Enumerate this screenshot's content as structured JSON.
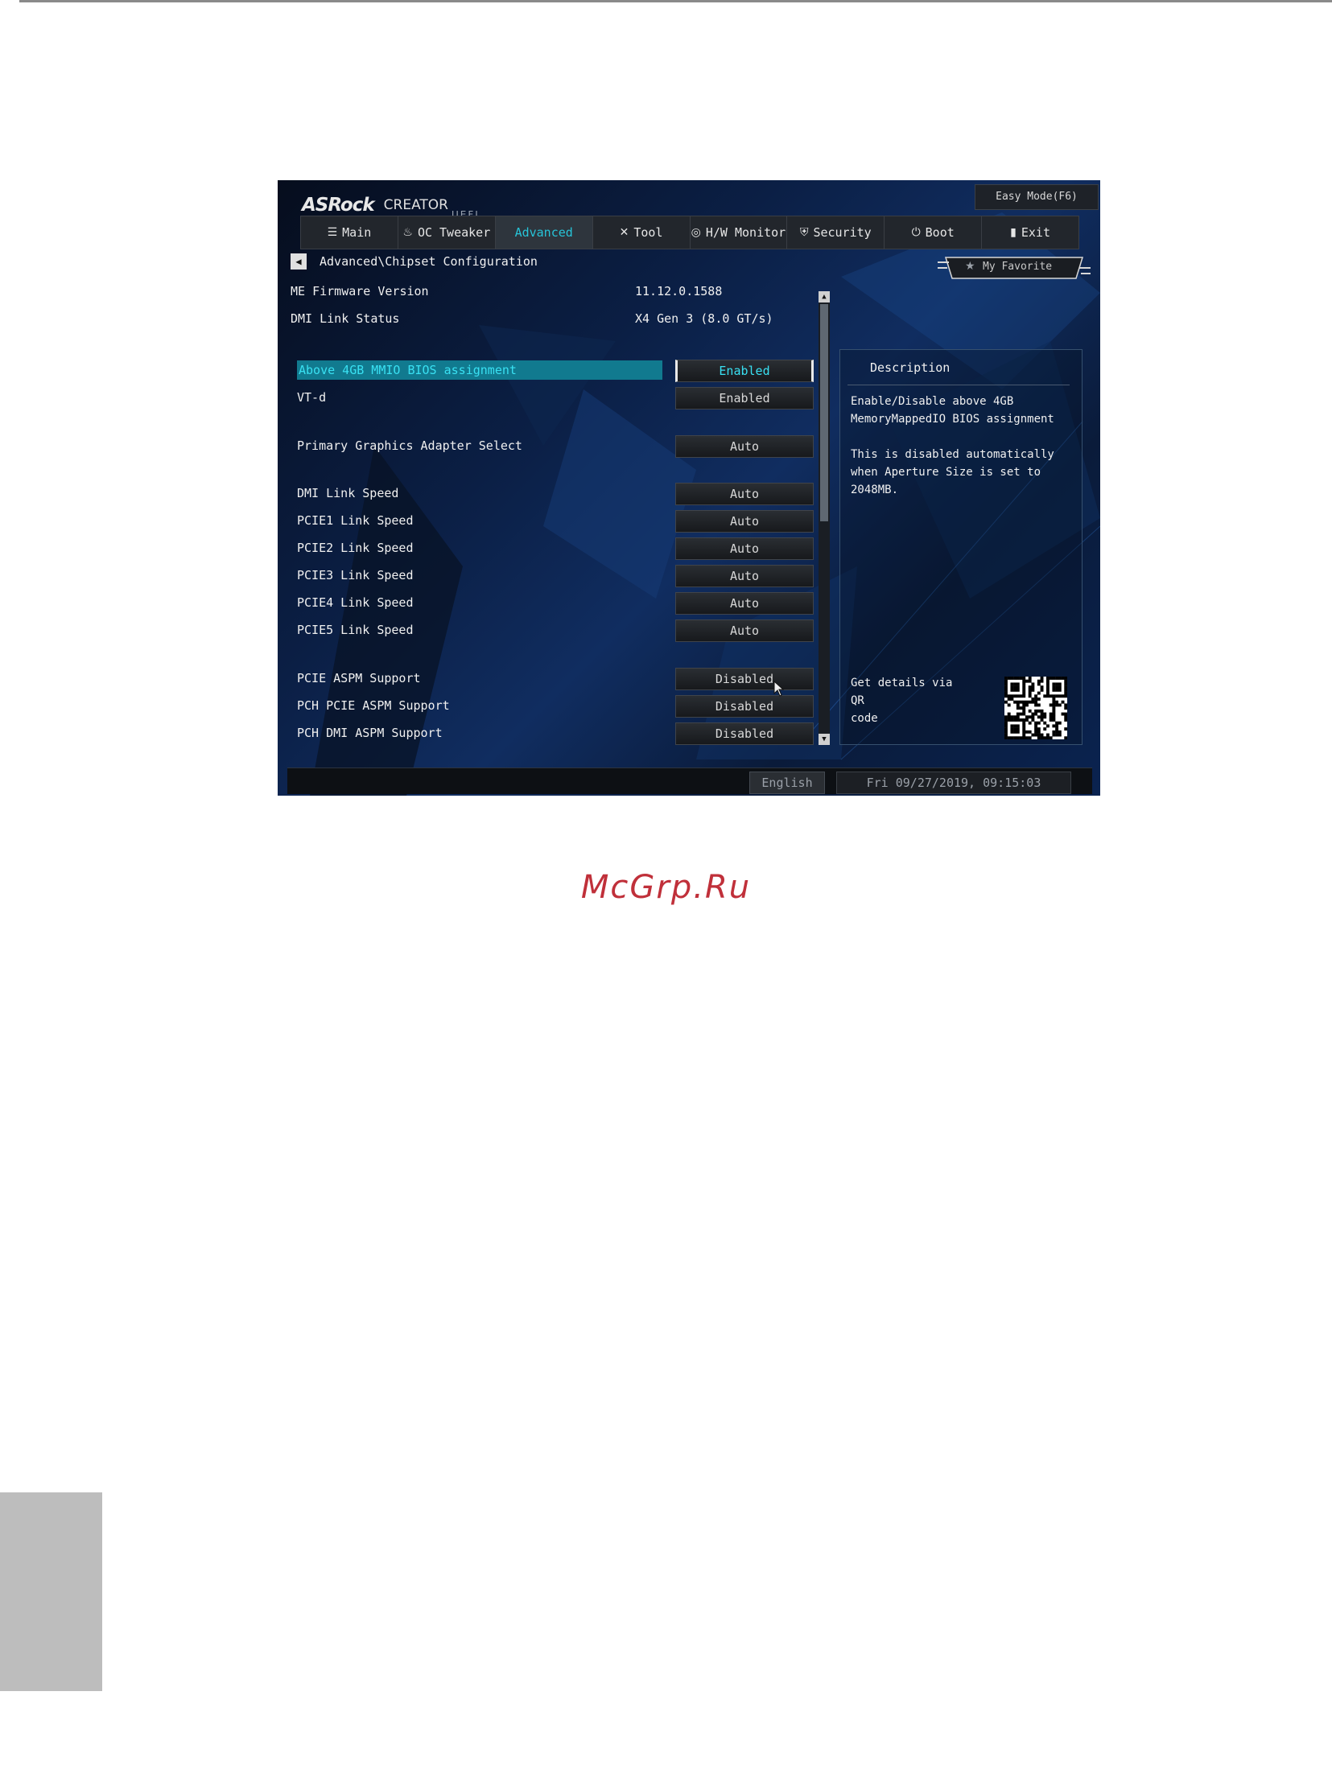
{
  "page": {
    "watermark": "McGrp.Ru"
  },
  "header": {
    "brand": "ASRock",
    "model": "CREATOR",
    "firmware_type": "UEFI",
    "easy_mode": "Easy Mode(F6)"
  },
  "tabs": [
    {
      "label": "Main",
      "icon": "list-icon"
    },
    {
      "label": "OC Tweaker",
      "icon": "flame-icon"
    },
    {
      "label": "Advanced",
      "icon": ""
    },
    {
      "label": "Tool",
      "icon": "tools-icon"
    },
    {
      "label": "H/W Monitor",
      "icon": "monitor-icon"
    },
    {
      "label": "Security",
      "icon": "shield-icon"
    },
    {
      "label": "Boot",
      "icon": "power-icon"
    },
    {
      "label": "Exit",
      "icon": "exit-door-icon"
    }
  ],
  "active_tab": "Advanced",
  "breadcrumb": "Advanced\\Chipset Configuration",
  "favorite": "My Favorite",
  "info": [
    {
      "label": "ME Firmware Version",
      "value": "11.12.0.1588"
    },
    {
      "label": "DMI Link Status",
      "value": "X4  Gen 3 (8.0 GT/s)"
    }
  ],
  "settings": [
    {
      "label": "Above 4GB MMIO BIOS assignment",
      "value": "Enabled",
      "selected": true
    },
    {
      "label": "VT-d",
      "value": "Enabled"
    },
    {
      "label": "Primary Graphics Adapter Select",
      "value": "Auto"
    },
    {
      "label": "DMI Link Speed",
      "value": "Auto"
    },
    {
      "label": "PCIE1 Link Speed",
      "value": "Auto"
    },
    {
      "label": "PCIE2 Link Speed",
      "value": "Auto"
    },
    {
      "label": "PCIE3 Link Speed",
      "value": "Auto"
    },
    {
      "label": "PCIE4 Link Speed",
      "value": "Auto"
    },
    {
      "label": "PCIE5 Link Speed",
      "value": "Auto"
    },
    {
      "label": "PCIE ASPM Support",
      "value": "Disabled"
    },
    {
      "label": "PCH PCIE ASPM Support",
      "value": "Disabled"
    },
    {
      "label": "PCH DMI ASPM Support",
      "value": "Disabled"
    }
  ],
  "description": {
    "title": "Description",
    "line1": "Enable/Disable above 4GB",
    "line2": "MemoryMappedIO BIOS assignment",
    "line3": "This is disabled automatically",
    "line4": "when Aperture Size is set to",
    "line5": "2048MB.",
    "qr_line1": "Get details via QR",
    "qr_line2": "code"
  },
  "footer": {
    "language": "English",
    "datetime": "Fri 09/27/2019, 09:15:03"
  },
  "colors": {
    "accent": "#27c4d8",
    "selected_row_bg": "#117a8f",
    "watermark": "#c0303a"
  }
}
